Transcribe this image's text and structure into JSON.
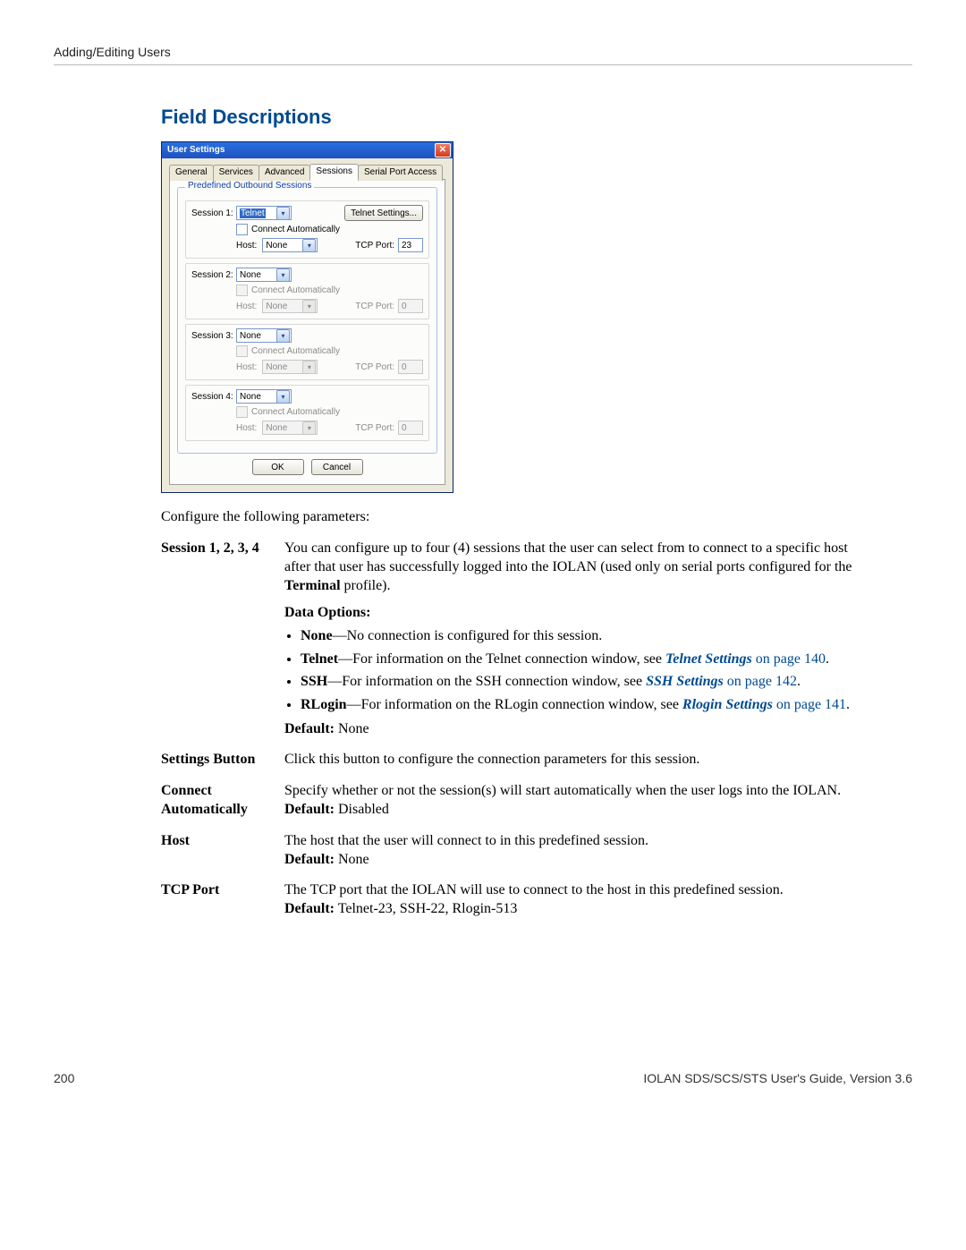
{
  "header": {
    "breadcrumb": "Adding/Editing Users"
  },
  "section_title": "Field Descriptions",
  "dialog": {
    "title": "User Settings",
    "tabs": [
      "General",
      "Services",
      "Advanced",
      "Sessions",
      "Serial Port Access"
    ],
    "active_tab": "Sessions",
    "group": "Predefined Outbound Sessions",
    "sessions": [
      {
        "label": "Session 1:",
        "type": "Telnet",
        "selected": true,
        "connect_auto": false,
        "connect_label": "Connect Automatically",
        "host_label": "Host:",
        "host": "None",
        "host_disabled": false,
        "settings_btn": "Telnet Settings...",
        "port_label": "TCP Port:",
        "port": "23",
        "port_disabled": false
      },
      {
        "label": "Session 2:",
        "type": "None",
        "selected": false,
        "connect_auto": false,
        "connect_label": "Connect Automatically",
        "host_label": "Host:",
        "host": "None",
        "host_disabled": true,
        "settings_btn": "",
        "port_label": "TCP Port:",
        "port": "0",
        "port_disabled": true
      },
      {
        "label": "Session 3:",
        "type": "None",
        "selected": false,
        "connect_auto": false,
        "connect_label": "Connect Automatically",
        "host_label": "Host:",
        "host": "None",
        "host_disabled": true,
        "settings_btn": "",
        "port_label": "TCP Port:",
        "port": "0",
        "port_disabled": true
      },
      {
        "label": "Session 4:",
        "type": "None",
        "selected": false,
        "connect_auto": false,
        "connect_label": "Connect Automatically",
        "host_label": "Host:",
        "host": "None",
        "host_disabled": true,
        "settings_btn": "",
        "port_label": "TCP Port:",
        "port": "0",
        "port_disabled": true
      }
    ],
    "ok": "OK",
    "cancel": "Cancel"
  },
  "intro": "Configure the following parameters:",
  "rows": {
    "r1": {
      "term": "Session 1, 2, 3, 4",
      "desc": "You can configure up to four (4) sessions that the user can select from to connect to a specific host after that user has successfully logged into the IOLAN (used only on serial ports configured for the ",
      "desc_bold": "Terminal",
      "desc_tail": " profile).",
      "opts_title": "Data Options:",
      "opt_none_b": "None",
      "opt_none_t": "—No connection is configured for this session.",
      "opt_telnet_b": "Telnet",
      "opt_telnet_t1": "—For information on the Telnet connection window, see ",
      "opt_telnet_link": "Telnet Settings",
      "opt_telnet_t2": " on page 140",
      "opt_telnet_t3": ".",
      "opt_ssh_b": "SSH",
      "opt_ssh_t1": "—For information on the SSH connection window, see ",
      "opt_ssh_link": "SSH Settings",
      "opt_ssh_t2": " on page 142",
      "opt_ssh_t3": ".",
      "opt_rl_b": "RLogin",
      "opt_rl_t1": "—For information on the RLogin connection window, see ",
      "opt_rl_link": "Rlogin Settings",
      "opt_rl_t2": " on page 141",
      "opt_rl_t3": ".",
      "default": "Default:",
      "default_v": " None"
    },
    "r2": {
      "term": "Settings Button",
      "desc": "Click this button to configure the connection parameters for this session."
    },
    "r3": {
      "term": "Connect Automatically",
      "desc": "Specify whether or not the session(s) will start automatically when the user logs into the IOLAN.",
      "default": "Default:",
      "default_v": " Disabled"
    },
    "r4": {
      "term": "Host",
      "desc": "The host that the user will connect to in this predefined session.",
      "default": "Default:",
      "default_v": " None"
    },
    "r5": {
      "term": "TCP Port",
      "desc": "The TCP port that the IOLAN will use to connect to the host in this predefined session.",
      "default": "Default:",
      "default_v": " Telnet-23, SSH-22, Rlogin-513"
    }
  },
  "footer": {
    "page": "200",
    "guide": "IOLAN SDS/SCS/STS User's Guide, Version 3.6"
  }
}
